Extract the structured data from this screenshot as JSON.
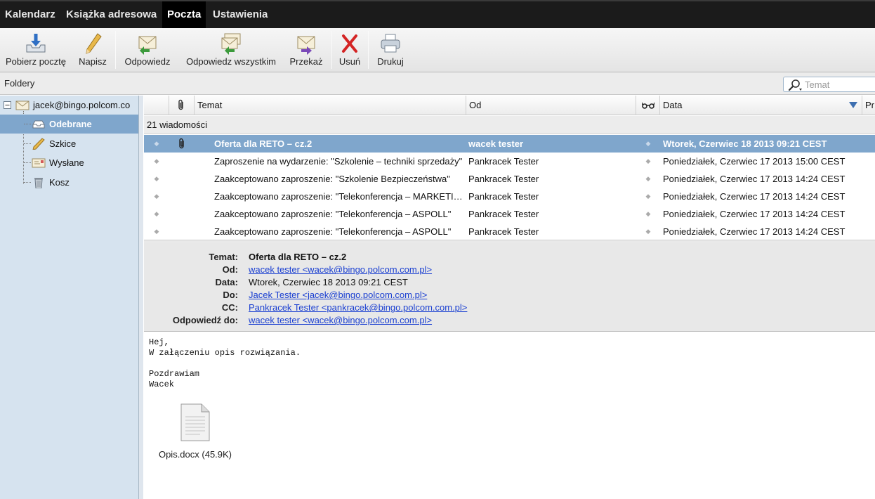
{
  "nav": {
    "items": [
      "Kalendarz",
      "Książka adresowa",
      "Poczta",
      "Ustawienia"
    ],
    "active": "Poczta"
  },
  "toolbar": {
    "get_mail": "Pobierz pocztę",
    "compose": "Napisz",
    "reply": "Odpowiedz",
    "reply_all": "Odpowiedz wszystkim",
    "forward": "Przekaż",
    "delete": "Usuń",
    "print": "Drukuj"
  },
  "folders": {
    "title": "Foldery",
    "account": "jacek@bingo.polcom.co",
    "items": [
      "Odebrane",
      "Szkice",
      "Wysłane",
      "Kosz"
    ],
    "selected": "Odebrane"
  },
  "search": {
    "placeholder": "Temat"
  },
  "list": {
    "columns": {
      "subject": "Temat",
      "from": "Od",
      "date": "Data",
      "extra": "Pr"
    },
    "count_label": "21 wiadomości",
    "messages": [
      {
        "subject": "Oferta dla RETO – cz.2",
        "from": "wacek tester",
        "date": "Wtorek, Czerwiec 18 2013 09:21 CEST"
      },
      {
        "subject": "Zaproszenie na wydarzenie: \"Szkolenie – techniki sprzedaży\"",
        "from": "Pankracek Tester",
        "date": "Poniedziałek, Czerwiec 17 2013 15:00 CEST"
      },
      {
        "subject": "Zaakceptowano zaproszenie: \"Szkolenie Bezpieczeństwa\"",
        "from": "Pankracek Tester",
        "date": "Poniedziałek, Czerwiec 17 2013 14:24 CEST"
      },
      {
        "subject": "Zaakceptowano zaproszenie: \"Telekonferencja – MARKETING\"",
        "from": "Pankracek Tester",
        "date": "Poniedziałek, Czerwiec 17 2013 14:24 CEST"
      },
      {
        "subject": "Zaakceptowano zaproszenie: \"Telekonferencja – ASPOLL\"",
        "from": "Pankracek Tester",
        "date": "Poniedziałek, Czerwiec 17 2013 14:24 CEST"
      },
      {
        "subject": "Zaakceptowano zaproszenie: \"Telekonferencja – ASPOLL\"",
        "from": "Pankracek Tester",
        "date": "Poniedziałek, Czerwiec 17 2013 14:24 CEST"
      }
    ]
  },
  "header": {
    "subject_label": "Temat:",
    "subject": "Oferta dla RETO – cz.2",
    "from_label": "Od:",
    "from": "wacek tester <wacek@bingo.polcom.com.pl>",
    "date_label": "Data:",
    "date": "Wtorek, Czerwiec 18 2013 09:21 CEST",
    "to_label": "Do:",
    "to": "Jacek Tester <jacek@bingo.polcom.com.pl>",
    "cc_label": "CC:",
    "cc": "Pankracek Tester <pankracek@bingo.polcom.com.pl>",
    "reply_to_label": "Odpowiedź do:",
    "reply_to": "wacek tester <wacek@bingo.polcom.com.pl>"
  },
  "body": {
    "text": "Hej,\nW załączeniu opis rozwiązania.\n\nPozdrawiam\nWacek",
    "attachment": "Opis.docx (45.9K)"
  },
  "colors": {
    "selection": "#7fa6cc",
    "sidebar": "#d6e3ef",
    "link": "#1a3fd1",
    "topbar": "#1b1b1b"
  }
}
